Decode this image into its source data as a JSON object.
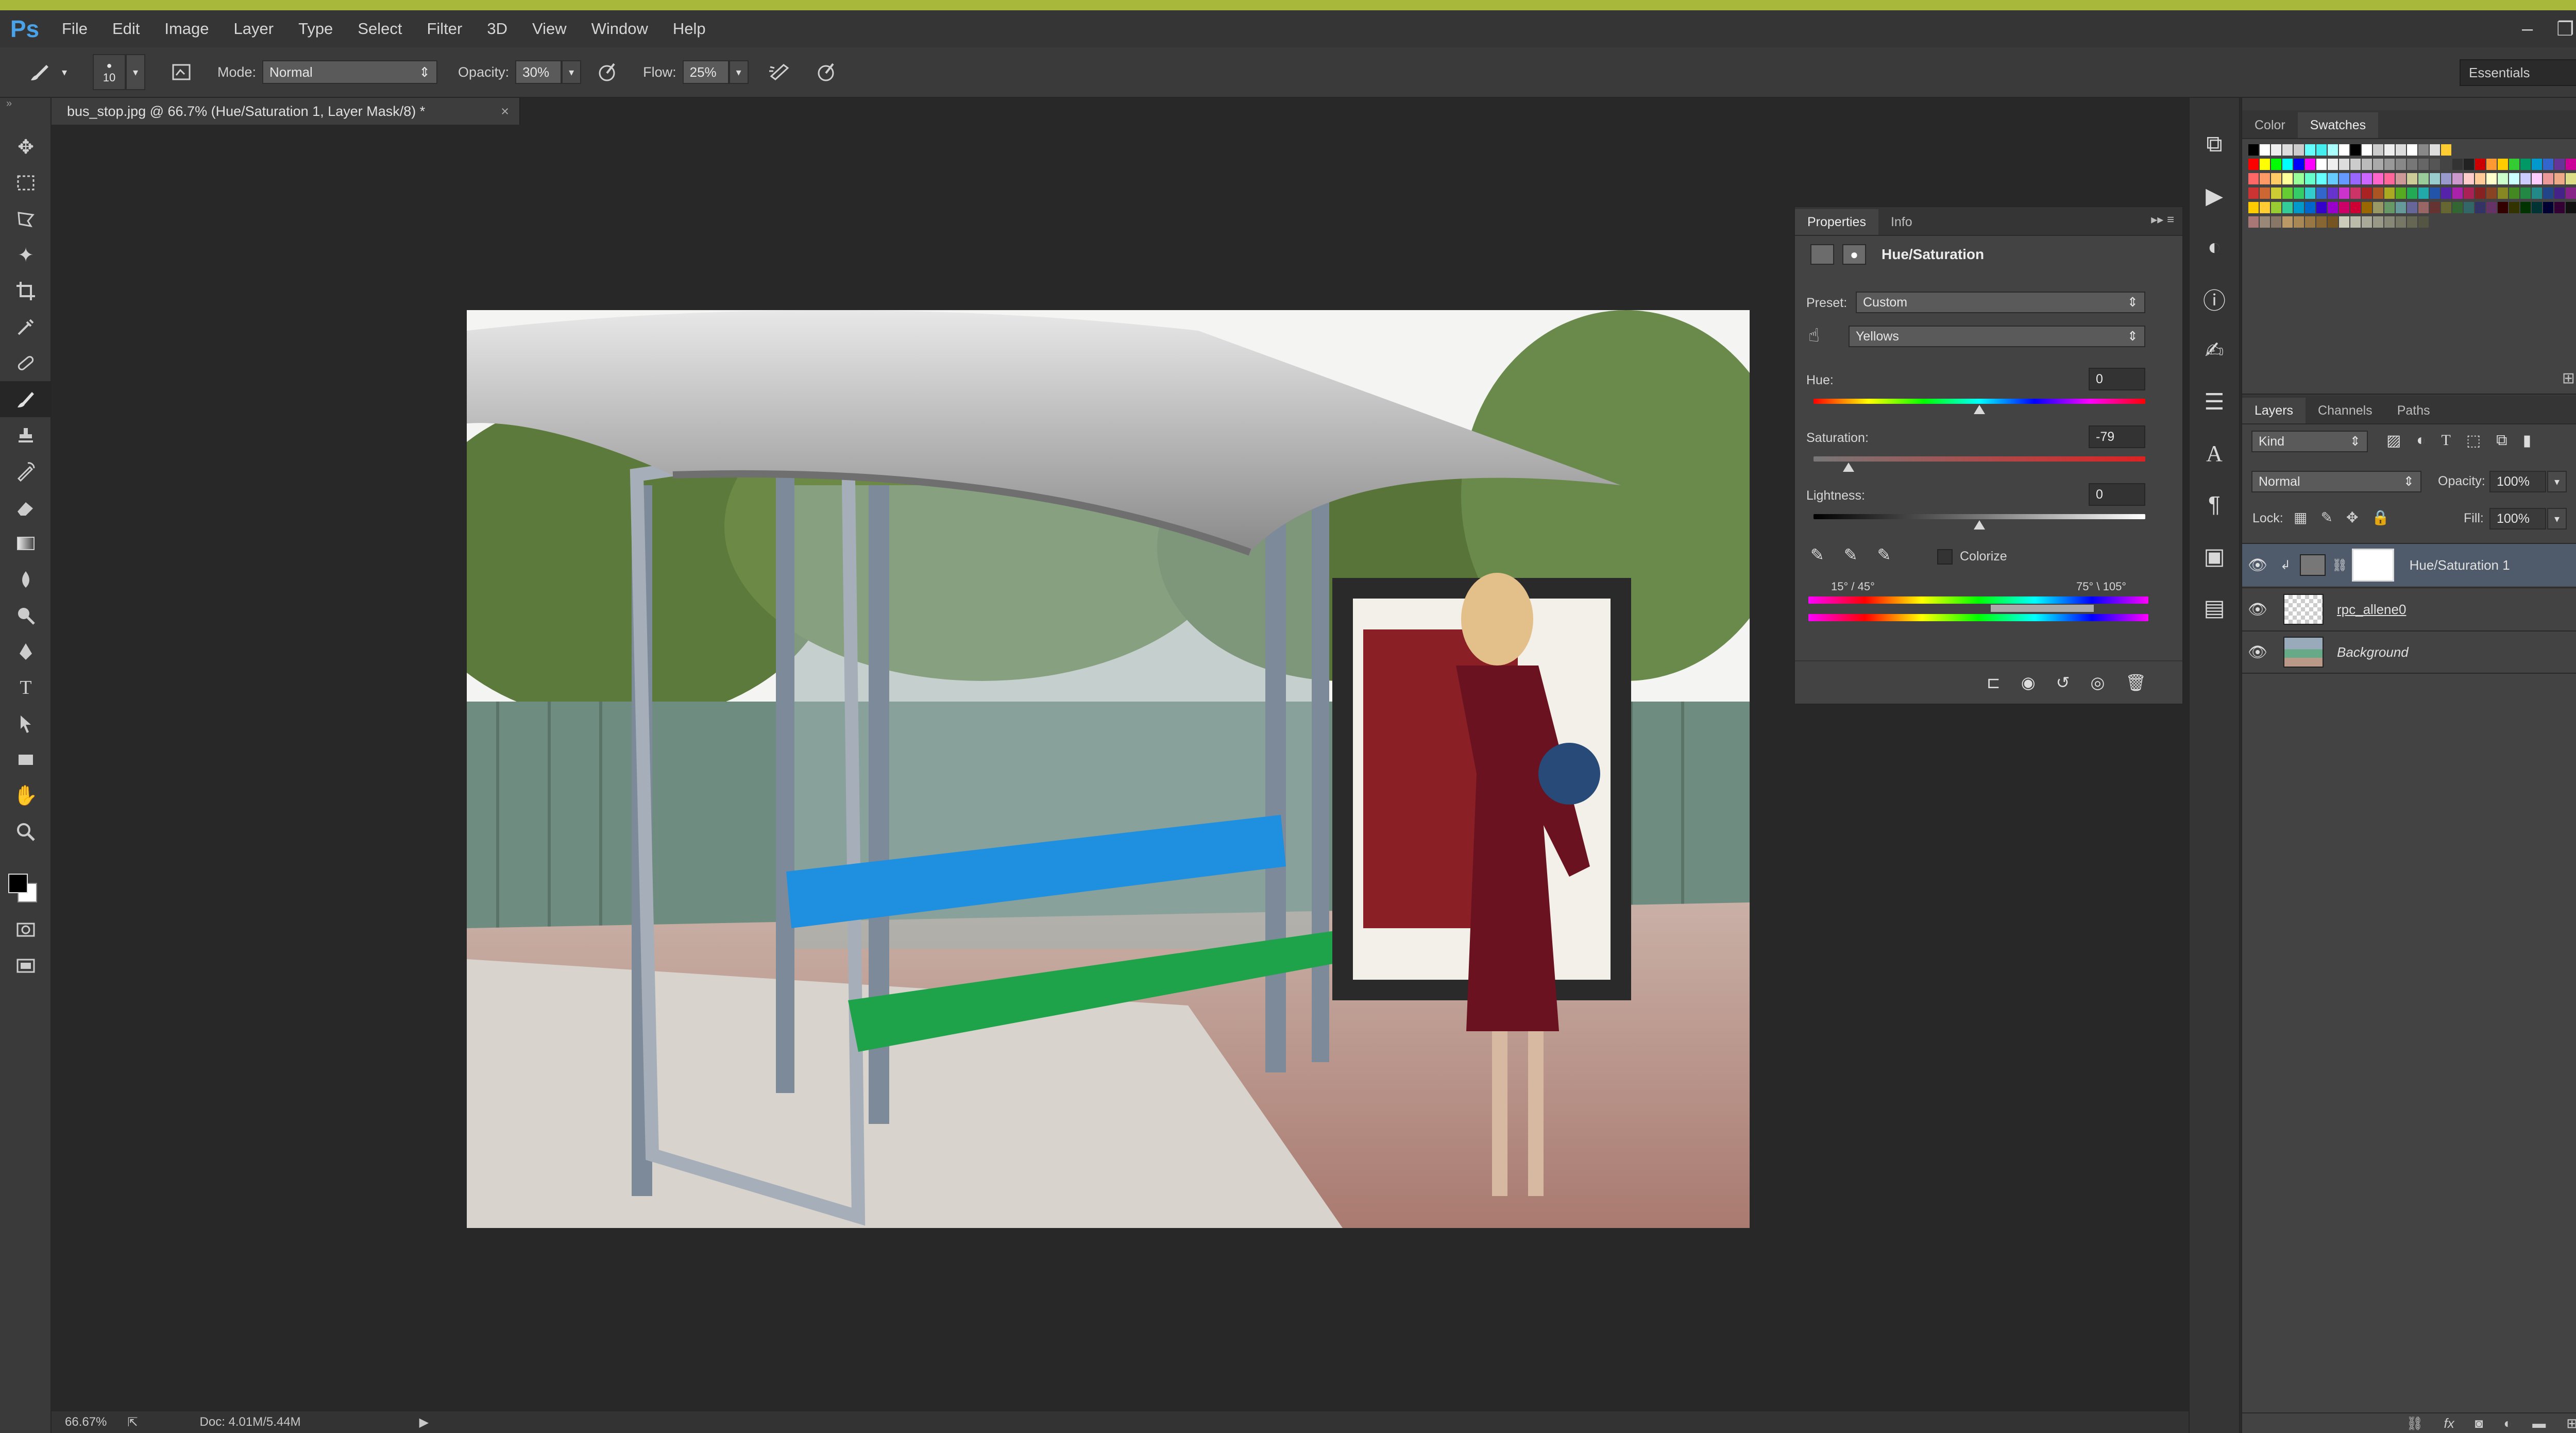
{
  "app": {
    "logo": "Ps"
  },
  "menu": [
    "File",
    "Edit",
    "Image",
    "Layer",
    "Type",
    "Select",
    "Filter",
    "3D",
    "View",
    "Window",
    "Help"
  ],
  "window_controls": {
    "minimize": "–",
    "restore": "❐",
    "close": "✕"
  },
  "options_bar": {
    "brush_size": "10",
    "mode_label": "Mode:",
    "mode_value": "Normal",
    "opacity_label": "Opacity:",
    "opacity_value": "30%",
    "flow_label": "Flow:",
    "flow_value": "25%",
    "workspace": "Essentials"
  },
  "document": {
    "tab_title": "bus_stop.jpg @ 66.7% (Hue/Saturation 1, Layer Mask/8) *",
    "tab_close": "×",
    "zoom": "66.67%",
    "doc_size": "Doc: 4.01M/5.44M"
  },
  "properties_panel": {
    "tabs": [
      "Properties",
      "Info"
    ],
    "title": "Hue/Saturation",
    "preset_label": "Preset:",
    "preset_value": "Custom",
    "channel_value": "Yellows",
    "hue_label": "Hue:",
    "hue_value": "0",
    "hue_level": 0.5,
    "saturation_label": "Saturation:",
    "saturation_value": "-79",
    "saturation_level": 0.105,
    "lightness_label": "Lightness:",
    "lightness_value": "0",
    "lightness_level": 0.5,
    "colorize_label": "Colorize",
    "colorize_checked": false,
    "range_left": "15° / 45°",
    "range_right": "75° \\ 105°"
  },
  "swatches_panel": {
    "tabs": [
      "Color",
      "Swatches"
    ],
    "active_tab": "Swatches"
  },
  "layers_panel": {
    "tabs": [
      "Layers",
      "Channels",
      "Paths"
    ],
    "filter_value": "Kind",
    "blend_mode": "Normal",
    "opacity_label": "Opacity:",
    "opacity_value": "100%",
    "lock_label": "Lock:",
    "fill_label": "Fill:",
    "fill_value": "100%",
    "layers": [
      {
        "name": "Hue/Saturation 1",
        "selected": true
      },
      {
        "name": "rpc_allene0",
        "selected": false
      },
      {
        "name": "Background",
        "selected": false,
        "locked": true
      }
    ]
  },
  "colors": {
    "accent_bar": "#a8b83a",
    "selected_layer": "#4f5a6b",
    "ps_logo": "#4aa3e8"
  }
}
